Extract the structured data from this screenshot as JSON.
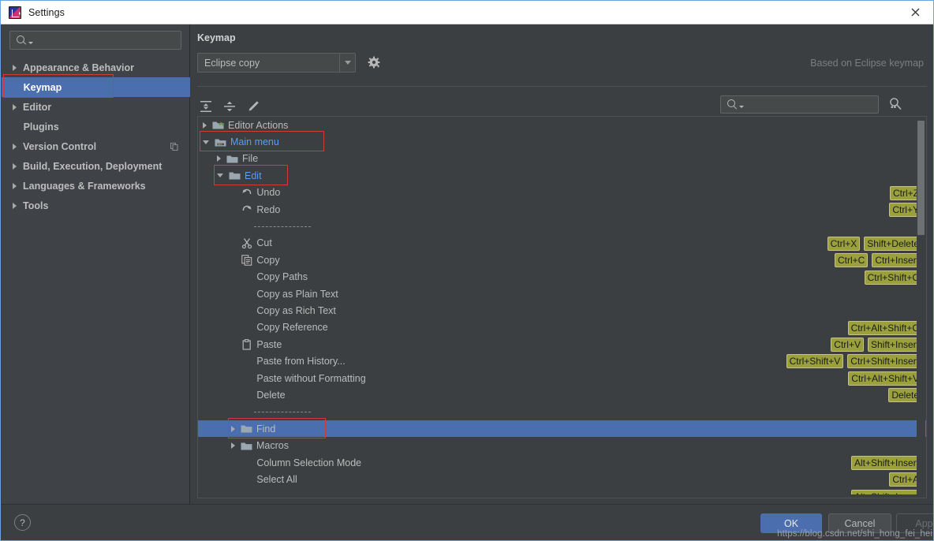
{
  "window": {
    "title": "Settings",
    "app_icon": "intellij-idea-icon",
    "close_icon": "close-icon"
  },
  "sidebar": {
    "search": {
      "value": "",
      "placeholder": "",
      "icon": "search-icon"
    },
    "items": [
      {
        "label": "Appearance & Behavior",
        "expandable": true,
        "selected": false
      },
      {
        "label": "Keymap",
        "expandable": false,
        "selected": true,
        "highlight_box": true
      },
      {
        "label": "Editor",
        "expandable": true,
        "selected": false
      },
      {
        "label": "Plugins",
        "expandable": false,
        "selected": false
      },
      {
        "label": "Version Control",
        "expandable": true,
        "selected": false,
        "trailing_icon": "copy-icon"
      },
      {
        "label": "Build, Execution, Deployment",
        "expandable": true,
        "selected": false
      },
      {
        "label": "Languages & Frameworks",
        "expandable": true,
        "selected": false
      },
      {
        "label": "Tools",
        "expandable": true,
        "selected": false
      }
    ]
  },
  "panel": {
    "title": "Keymap",
    "keymap_select": {
      "value": "Eclipse copy",
      "icon": "chevron-down-icon"
    },
    "gear_icon": "gear-icon",
    "based_on": "Based on Eclipse keymap",
    "toolbar": {
      "expand_all_icon": "expand-all-icon",
      "collapse_all_icon": "collapse-all-icon",
      "edit_icon": "pencil-edit-icon",
      "search": {
        "value": "",
        "placeholder": "",
        "icon": "search-icon"
      },
      "find_by_shortcut_icon": "find-by-shortcut-icon"
    }
  },
  "tree": {
    "rows": [
      {
        "indent": 0,
        "arrow": "right",
        "icon": "editor-actions-folder-icon",
        "label": "Editor Actions",
        "link": false,
        "shortcuts": []
      },
      {
        "indent": 0,
        "arrow": "down",
        "icon": "main-menu-folder-icon",
        "label": "Main menu",
        "link": true,
        "box": true,
        "shortcuts": []
      },
      {
        "indent": 1,
        "arrow": "right",
        "icon": "folder-icon",
        "label": "File",
        "link": false,
        "shortcuts": []
      },
      {
        "indent": 1,
        "arrow": "down",
        "icon": "folder-icon",
        "label": "Edit",
        "link": true,
        "box": true,
        "shortcuts": []
      },
      {
        "indent": 2,
        "arrow": "none",
        "icon": "undo-icon",
        "label": "Undo",
        "link": false,
        "shortcuts": [
          "Ctrl+Z"
        ]
      },
      {
        "indent": 2,
        "arrow": "none",
        "icon": "redo-icon",
        "label": "Redo",
        "link": false,
        "shortcuts": [
          "Ctrl+Y"
        ]
      },
      {
        "indent": 2,
        "arrow": "none",
        "icon": "none",
        "label": "",
        "separator": true,
        "shortcuts": []
      },
      {
        "indent": 2,
        "arrow": "none",
        "icon": "cut-icon",
        "label": "Cut",
        "link": false,
        "shortcuts": [
          "Ctrl+X",
          "Shift+Delete"
        ]
      },
      {
        "indent": 2,
        "arrow": "none",
        "icon": "copy-icon",
        "label": "Copy",
        "link": false,
        "shortcuts": [
          "Ctrl+C",
          "Ctrl+Insert"
        ]
      },
      {
        "indent": 2,
        "arrow": "none",
        "icon": "none",
        "label": "Copy Paths",
        "link": false,
        "shortcuts": [
          "Ctrl+Shift+C"
        ]
      },
      {
        "indent": 2,
        "arrow": "none",
        "icon": "none",
        "label": "Copy as Plain Text",
        "link": false,
        "shortcuts": []
      },
      {
        "indent": 2,
        "arrow": "none",
        "icon": "none",
        "label": "Copy as Rich Text",
        "link": false,
        "shortcuts": []
      },
      {
        "indent": 2,
        "arrow": "none",
        "icon": "none",
        "label": "Copy Reference",
        "link": false,
        "shortcuts": [
          "Ctrl+Alt+Shift+C"
        ]
      },
      {
        "indent": 2,
        "arrow": "none",
        "icon": "paste-icon",
        "label": "Paste",
        "link": false,
        "shortcuts": [
          "Ctrl+V",
          "Shift+Insert"
        ]
      },
      {
        "indent": 2,
        "arrow": "none",
        "icon": "none",
        "label": "Paste from History...",
        "link": false,
        "shortcuts": [
          "Ctrl+Shift+V",
          "Ctrl+Shift+Insert"
        ]
      },
      {
        "indent": 2,
        "arrow": "none",
        "icon": "none",
        "label": "Paste without Formatting",
        "link": false,
        "shortcuts": [
          "Ctrl+Alt+Shift+V"
        ]
      },
      {
        "indent": 2,
        "arrow": "none",
        "icon": "none",
        "label": "Delete",
        "link": false,
        "shortcuts": [
          "Delete"
        ]
      },
      {
        "indent": 2,
        "arrow": "none",
        "icon": "none",
        "label": "",
        "separator": true,
        "shortcuts": []
      },
      {
        "indent": 2,
        "arrow": "right",
        "icon": "folder-icon",
        "label": "Find",
        "link": false,
        "selected": true,
        "box": true,
        "shortcuts": []
      },
      {
        "indent": 2,
        "arrow": "right",
        "icon": "folder-icon",
        "label": "Macros",
        "link": false,
        "shortcuts": []
      },
      {
        "indent": 2,
        "arrow": "none",
        "icon": "none",
        "label": "Column Selection Mode",
        "link": false,
        "shortcuts": [
          "Alt+Shift+Insert"
        ]
      },
      {
        "indent": 2,
        "arrow": "none",
        "icon": "none",
        "label": "Select All",
        "link": false,
        "shortcuts": [
          "Ctrl+A"
        ]
      },
      {
        "indent": 2,
        "arrow": "none",
        "icon": "none",
        "label": "",
        "link": false,
        "clipped": true,
        "shortcuts": [
          "Alt+Shift+Insert"
        ]
      }
    ]
  },
  "footer": {
    "help_label": "?",
    "ok_label": "OK",
    "cancel_label": "Cancel",
    "apply_label": "Apply"
  },
  "watermark": "https://blog.csdn.net/shi_hong_fei_hei",
  "colors": {
    "selection_blue": "#4b6eaf",
    "link_blue": "#589df6",
    "shortcut_badge": "#9aa03c",
    "annotation_red": "#cf3a3a",
    "panel_bg": "#3c3f41",
    "sidebar_bg": "#3f4247"
  }
}
